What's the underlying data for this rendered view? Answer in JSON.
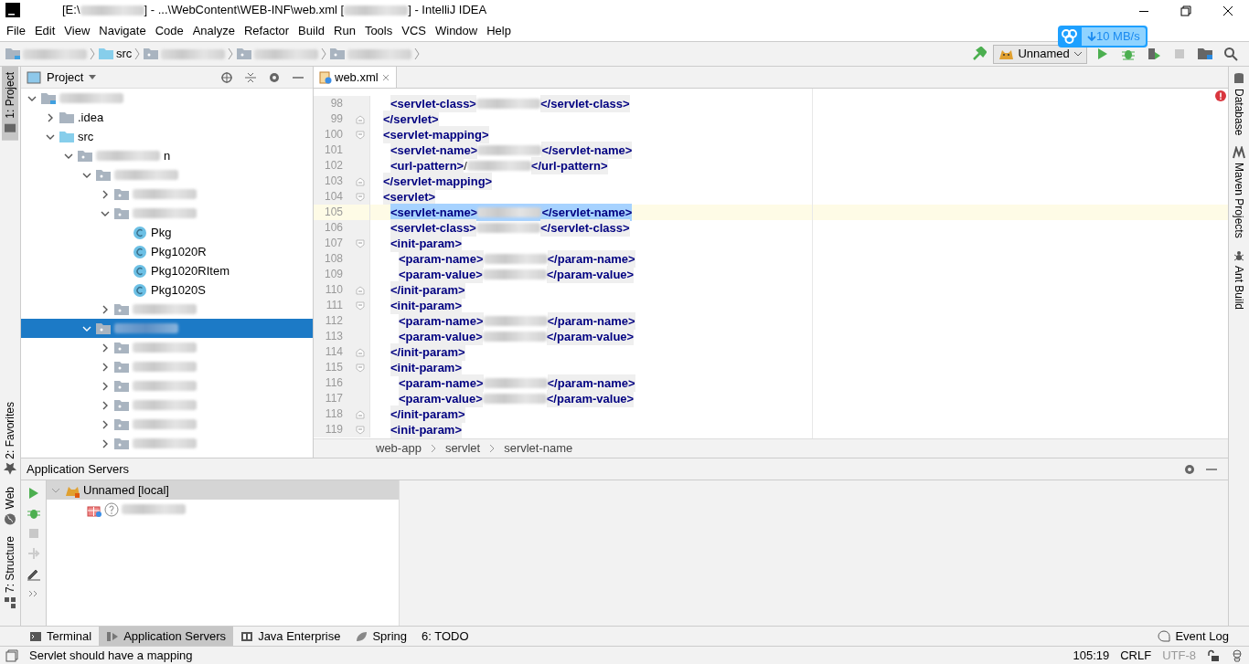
{
  "window": {
    "title": [
      {
        "kind": "text",
        "text": "[E:\\"
      },
      {
        "kind": "blurred"
      },
      {
        "kind": "text",
        "text": "] - ...\\WebContent\\WEB-INF\\web.xml ["
      },
      {
        "kind": "blurred"
      },
      {
        "kind": "text",
        "text": "] - IntelliJ IDEA"
      }
    ]
  },
  "menu": [
    "File",
    "Edit",
    "View",
    "Navigate",
    "Code",
    "Analyze",
    "Refactor",
    "Build",
    "Run",
    "Tools",
    "VCS",
    "Window",
    "Help"
  ],
  "nav_bar": {
    "crumbs": [
      {
        "kind": "module",
        "segments": [
          {
            "kind": "blurred"
          }
        ]
      },
      {
        "kind": "source",
        "segments": [
          {
            "kind": "text",
            "text": "src"
          }
        ]
      },
      {
        "kind": "package",
        "segments": [
          {
            "kind": "blurred"
          }
        ]
      },
      {
        "kind": "package",
        "segments": [
          {
            "kind": "blurred"
          }
        ]
      },
      {
        "kind": "package",
        "segments": [
          {
            "kind": "blurred"
          }
        ]
      }
    ],
    "run_config": "Unnamed"
  },
  "transfer_widget": {
    "speed": "10 MB/s"
  },
  "left_stripe": [
    {
      "label": "1: Project",
      "kind": "project",
      "selected": true
    },
    {
      "label": "2: Favorites",
      "kind": "favorites",
      "selected": false
    },
    {
      "label": "Web",
      "kind": "web",
      "selected": false
    },
    {
      "label": "7: Structure",
      "kind": "structure",
      "selected": false
    }
  ],
  "right_stripe": [
    {
      "label": "Database",
      "kind": "database"
    },
    {
      "label": "Maven Projects",
      "kind": "maven"
    },
    {
      "label": "Ant Build",
      "kind": "ant"
    }
  ],
  "project_panel": {
    "title": "Project",
    "tree": [
      {
        "kind": "module",
        "segments": [
          {
            "kind": "blurred"
          }
        ],
        "expanded": true,
        "selected": false,
        "children": [
          {
            "kind": "folder",
            "segments": [
              {
                "kind": "text",
                "text": ".idea"
              }
            ],
            "expanded": false,
            "selected": false
          },
          {
            "kind": "source",
            "segments": [
              {
                "kind": "text",
                "text": "src"
              }
            ],
            "expanded": true,
            "selected": false,
            "children": [
              {
                "kind": "package",
                "segments": [
                  {
                    "kind": "blurred"
                  },
                  {
                    "kind": "text",
                    "text": "n"
                  }
                ],
                "expanded": true,
                "selected": false,
                "children": [
                  {
                    "kind": "package",
                    "segments": [
                      {
                        "kind": "blurred"
                      }
                    ],
                    "expanded": true,
                    "selected": false,
                    "children": [
                      {
                        "kind": "package",
                        "segments": [
                          {
                            "kind": "blurred"
                          }
                        ],
                        "expanded": false,
                        "selected": false
                      },
                      {
                        "kind": "package",
                        "segments": [
                          {
                            "kind": "blurred"
                          }
                        ],
                        "expanded": true,
                        "selected": false,
                        "children": [
                          {
                            "kind": "class",
                            "segments": [
                              {
                                "kind": "text",
                                "text": "Pkg"
                              }
                            ],
                            "selected": false
                          },
                          {
                            "kind": "class",
                            "segments": [
                              {
                                "kind": "text",
                                "text": "Pkg1020R"
                              }
                            ],
                            "selected": false
                          },
                          {
                            "kind": "class",
                            "segments": [
                              {
                                "kind": "text",
                                "text": "Pkg1020RItem"
                              }
                            ],
                            "selected": false
                          },
                          {
                            "kind": "class",
                            "segments": [
                              {
                                "kind": "text",
                                "text": "Pkg1020S"
                              }
                            ],
                            "selected": false
                          }
                        ]
                      },
                      {
                        "kind": "package",
                        "segments": [
                          {
                            "kind": "blurred"
                          }
                        ],
                        "expanded": false,
                        "selected": false
                      }
                    ]
                  },
                  {
                    "kind": "package",
                    "segments": [
                      {
                        "kind": "blurred"
                      }
                    ],
                    "expanded": true,
                    "selected": true,
                    "children": [
                      {
                        "kind": "package",
                        "segments": [
                          {
                            "kind": "blurred"
                          }
                        ],
                        "expanded": false,
                        "selected": false
                      },
                      {
                        "kind": "package",
                        "segments": [
                          {
                            "kind": "blurred"
                          }
                        ],
                        "expanded": false,
                        "selected": false
                      },
                      {
                        "kind": "package",
                        "segments": [
                          {
                            "kind": "blurred"
                          }
                        ],
                        "expanded": false,
                        "selected": false
                      },
                      {
                        "kind": "package",
                        "segments": [
                          {
                            "kind": "blurred"
                          }
                        ],
                        "expanded": false,
                        "selected": false
                      },
                      {
                        "kind": "package",
                        "segments": [
                          {
                            "kind": "blurred"
                          }
                        ],
                        "expanded": false,
                        "selected": false
                      },
                      {
                        "kind": "package",
                        "segments": [
                          {
                            "kind": "blurred"
                          }
                        ],
                        "expanded": false,
                        "selected": false
                      }
                    ]
                  }
                ]
              }
            ]
          }
        ]
      }
    ]
  },
  "editor": {
    "tabs": [
      {
        "label": "web.xml",
        "selected": true
      }
    ],
    "lines": [
      {
        "number": "98",
        "kind": "child",
        "open": "<servlet-class>",
        "value": [
          {
            "kind": "blurred"
          }
        ],
        "close": "</servlet-class>",
        "fold_start": false,
        "fold_end": false,
        "current": false,
        "selected": false
      },
      {
        "number": "99",
        "kind": "block",
        "open": "</servlet>",
        "fold_start": false,
        "fold_end": true,
        "current": false,
        "selected": false
      },
      {
        "number": "100",
        "kind": "block",
        "open": "<servlet-mapping>",
        "fold_start": true,
        "fold_end": false,
        "current": false,
        "selected": false
      },
      {
        "number": "101",
        "kind": "child",
        "open": "<servlet-name>",
        "value": [
          {
            "kind": "blurred"
          }
        ],
        "close": "</servlet-name>",
        "fold_start": false,
        "fold_end": false,
        "current": false,
        "selected": false
      },
      {
        "number": "102",
        "kind": "child",
        "open": "<url-pattern>",
        "value": [
          {
            "kind": "text",
            "text": "/"
          },
          {
            "kind": "blurred"
          }
        ],
        "close": "</url-pattern>",
        "fold_start": false,
        "fold_end": false,
        "current": false,
        "selected": false
      },
      {
        "number": "103",
        "kind": "block",
        "open": "</servlet-mapping>",
        "fold_start": false,
        "fold_end": true,
        "current": false,
        "selected": false
      },
      {
        "number": "104",
        "kind": "block",
        "open": "<servlet>",
        "fold_start": true,
        "fold_end": false,
        "current": false,
        "selected": false
      },
      {
        "number": "105",
        "kind": "child",
        "open": "<servlet-name>",
        "value": [
          {
            "kind": "blurred"
          }
        ],
        "close": "</servlet-name>",
        "fold_start": false,
        "fold_end": false,
        "current": true,
        "selected": true
      },
      {
        "number": "106",
        "kind": "child",
        "open": "<servlet-class>",
        "value": [
          {
            "kind": "blurred"
          }
        ],
        "close": "</servlet-class>",
        "fold_start": false,
        "fold_end": false,
        "current": false,
        "selected": false
      },
      {
        "number": "107",
        "kind": "child",
        "open": "<init-param>",
        "fold_start": true,
        "fold_end": false,
        "current": false,
        "selected": false
      },
      {
        "number": "108",
        "kind": "grandchild",
        "open": "<param-name>",
        "value": [
          {
            "kind": "blurred"
          }
        ],
        "close": "</param-name>",
        "fold_start": false,
        "fold_end": false,
        "current": false,
        "selected": false
      },
      {
        "number": "109",
        "kind": "grandchild",
        "open": "<param-value>",
        "value": [
          {
            "kind": "blurred"
          }
        ],
        "close": "</param-value>",
        "fold_start": false,
        "fold_end": false,
        "current": false,
        "selected": false
      },
      {
        "number": "110",
        "kind": "child",
        "open": "</init-param>",
        "fold_start": false,
        "fold_end": true,
        "current": false,
        "selected": false
      },
      {
        "number": "111",
        "kind": "child",
        "open": "<init-param>",
        "fold_start": true,
        "fold_end": false,
        "current": false,
        "selected": false
      },
      {
        "number": "112",
        "kind": "grandchild",
        "open": "<param-name>",
        "value": [
          {
            "kind": "blurred"
          }
        ],
        "close": "</param-name>",
        "fold_start": false,
        "fold_end": false,
        "current": false,
        "selected": false
      },
      {
        "number": "113",
        "kind": "grandchild",
        "open": "<param-value>",
        "value": [
          {
            "kind": "blurred"
          }
        ],
        "close": "</param-value>",
        "fold_start": false,
        "fold_end": false,
        "current": false,
        "selected": false
      },
      {
        "number": "114",
        "kind": "child",
        "open": "</init-param>",
        "fold_start": false,
        "fold_end": true,
        "current": false,
        "selected": false
      },
      {
        "number": "115",
        "kind": "child",
        "open": "<init-param>",
        "fold_start": true,
        "fold_end": false,
        "current": false,
        "selected": false
      },
      {
        "number": "116",
        "kind": "grandchild",
        "open": "<param-name>",
        "value": [
          {
            "kind": "blurred"
          }
        ],
        "close": "</param-name>",
        "fold_start": false,
        "fold_end": false,
        "current": false,
        "selected": false
      },
      {
        "number": "117",
        "kind": "grandchild",
        "open": "<param-value>",
        "value": [
          {
            "kind": "blurred"
          }
        ],
        "close": "</param-value>",
        "fold_start": false,
        "fold_end": false,
        "current": false,
        "selected": false
      },
      {
        "number": "118",
        "kind": "child",
        "open": "</init-param>",
        "fold_start": false,
        "fold_end": true,
        "current": false,
        "selected": false
      },
      {
        "number": "119",
        "kind": "child",
        "open": "<init-param>",
        "fold_start": true,
        "fold_end": false,
        "current": false,
        "selected": false
      }
    ],
    "breadcrumbs": [
      "web-app",
      "servlet",
      "servlet-name"
    ]
  },
  "app_servers": {
    "title": "Application Servers",
    "servers": [
      {
        "label": "Unnamed [local]",
        "expanded": true,
        "selected": true,
        "children": [
          {
            "segments": [
              {
                "kind": "blurred"
              }
            ]
          }
        ]
      }
    ]
  },
  "bottom_tabs": [
    {
      "label": "Terminal",
      "kind": "terminal",
      "selected": false
    },
    {
      "label": "Application Servers",
      "kind": "servers",
      "selected": true
    },
    {
      "label": "Java Enterprise",
      "kind": "javaee",
      "selected": false
    },
    {
      "label": "Spring",
      "kind": "spring",
      "selected": false
    },
    {
      "label": "6: TODO",
      "kind": "todo",
      "selected": false
    }
  ],
  "event_log": "Event Log",
  "status_bar": {
    "message": "Servlet should have a mapping",
    "position": "105:19",
    "line_separator": "CRLF",
    "encoding": "UTF-8"
  }
}
